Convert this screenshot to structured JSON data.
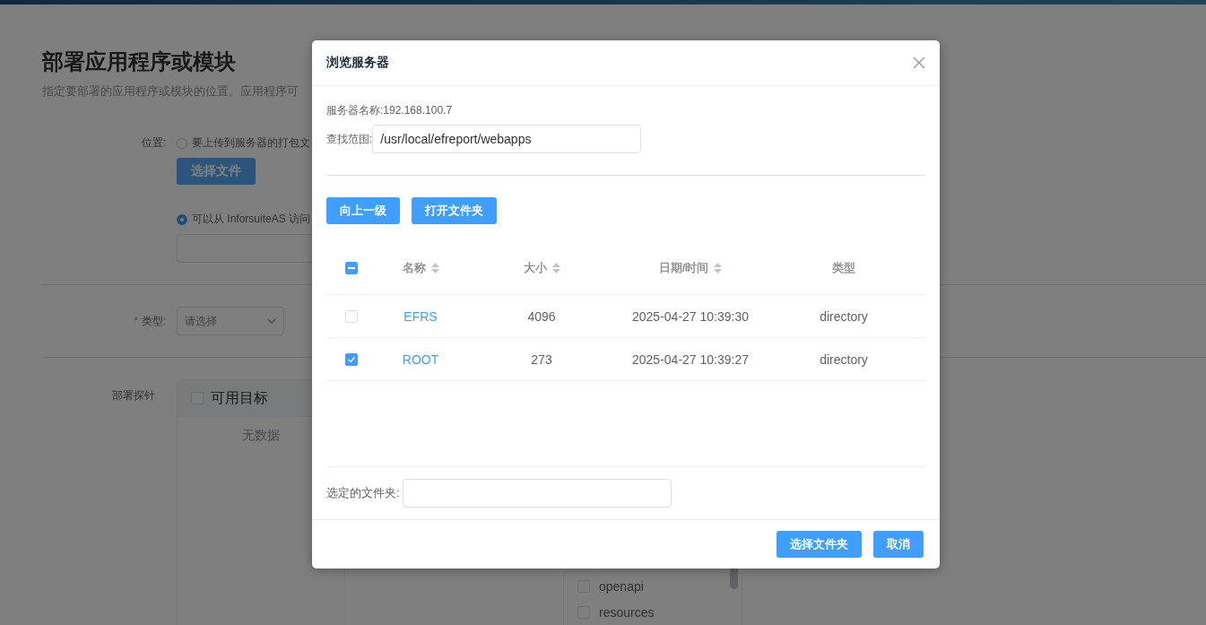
{
  "page": {
    "title": "部署应用程序或模块",
    "description": "指定要部署的应用程序或模块的位置。应用程序可",
    "location_label": "位置:",
    "upload_option": {
      "label": "要上传到服务器的打包文",
      "selected": false
    },
    "choose_file_button": {
      "label": "选择文件",
      "disabled": true
    },
    "access_option": {
      "label": "可以从 InforsuiteAS 访问",
      "selected": true
    },
    "type_field": {
      "required_mark": "*",
      "label": "类型:",
      "placeholder": "请选择"
    },
    "probe_label": "部署探针",
    "available_targets": {
      "title": "可用目标",
      "checked": false,
      "empty_text": "无数据"
    },
    "target_list": [
      {
        "label": "openapi",
        "checked": false
      },
      {
        "label": "resources",
        "checked": false
      }
    ]
  },
  "dialog": {
    "title": "浏览服务器",
    "server_name": "服务器名称:192.168.100.7",
    "scope_label": "查找范围:",
    "scope_value": "/usr/local/efreport/webapps",
    "buttons": [
      "向上一级",
      "打开文件夹"
    ],
    "table": {
      "select_all": {
        "indeterminate": true
      },
      "columns": [
        {
          "label": "名称",
          "sortable": true
        },
        {
          "label": "大小",
          "sortable": true
        },
        {
          "label": "日期/时间",
          "sortable": true
        },
        {
          "label": "类型",
          "sortable": false
        }
      ],
      "rows": [
        {
          "checked": false,
          "name": "EFRS",
          "size": "4096",
          "date": "2025-04-27 10:39:30",
          "type": "directory"
        },
        {
          "checked": true,
          "name": "ROOT",
          "size": "273",
          "date": "2025-04-27 10:39:27",
          "type": "directory"
        }
      ]
    },
    "selected_folder_label": "选定的文件夹:",
    "footer_buttons": [
      "选择文件夹",
      "取消"
    ]
  }
}
